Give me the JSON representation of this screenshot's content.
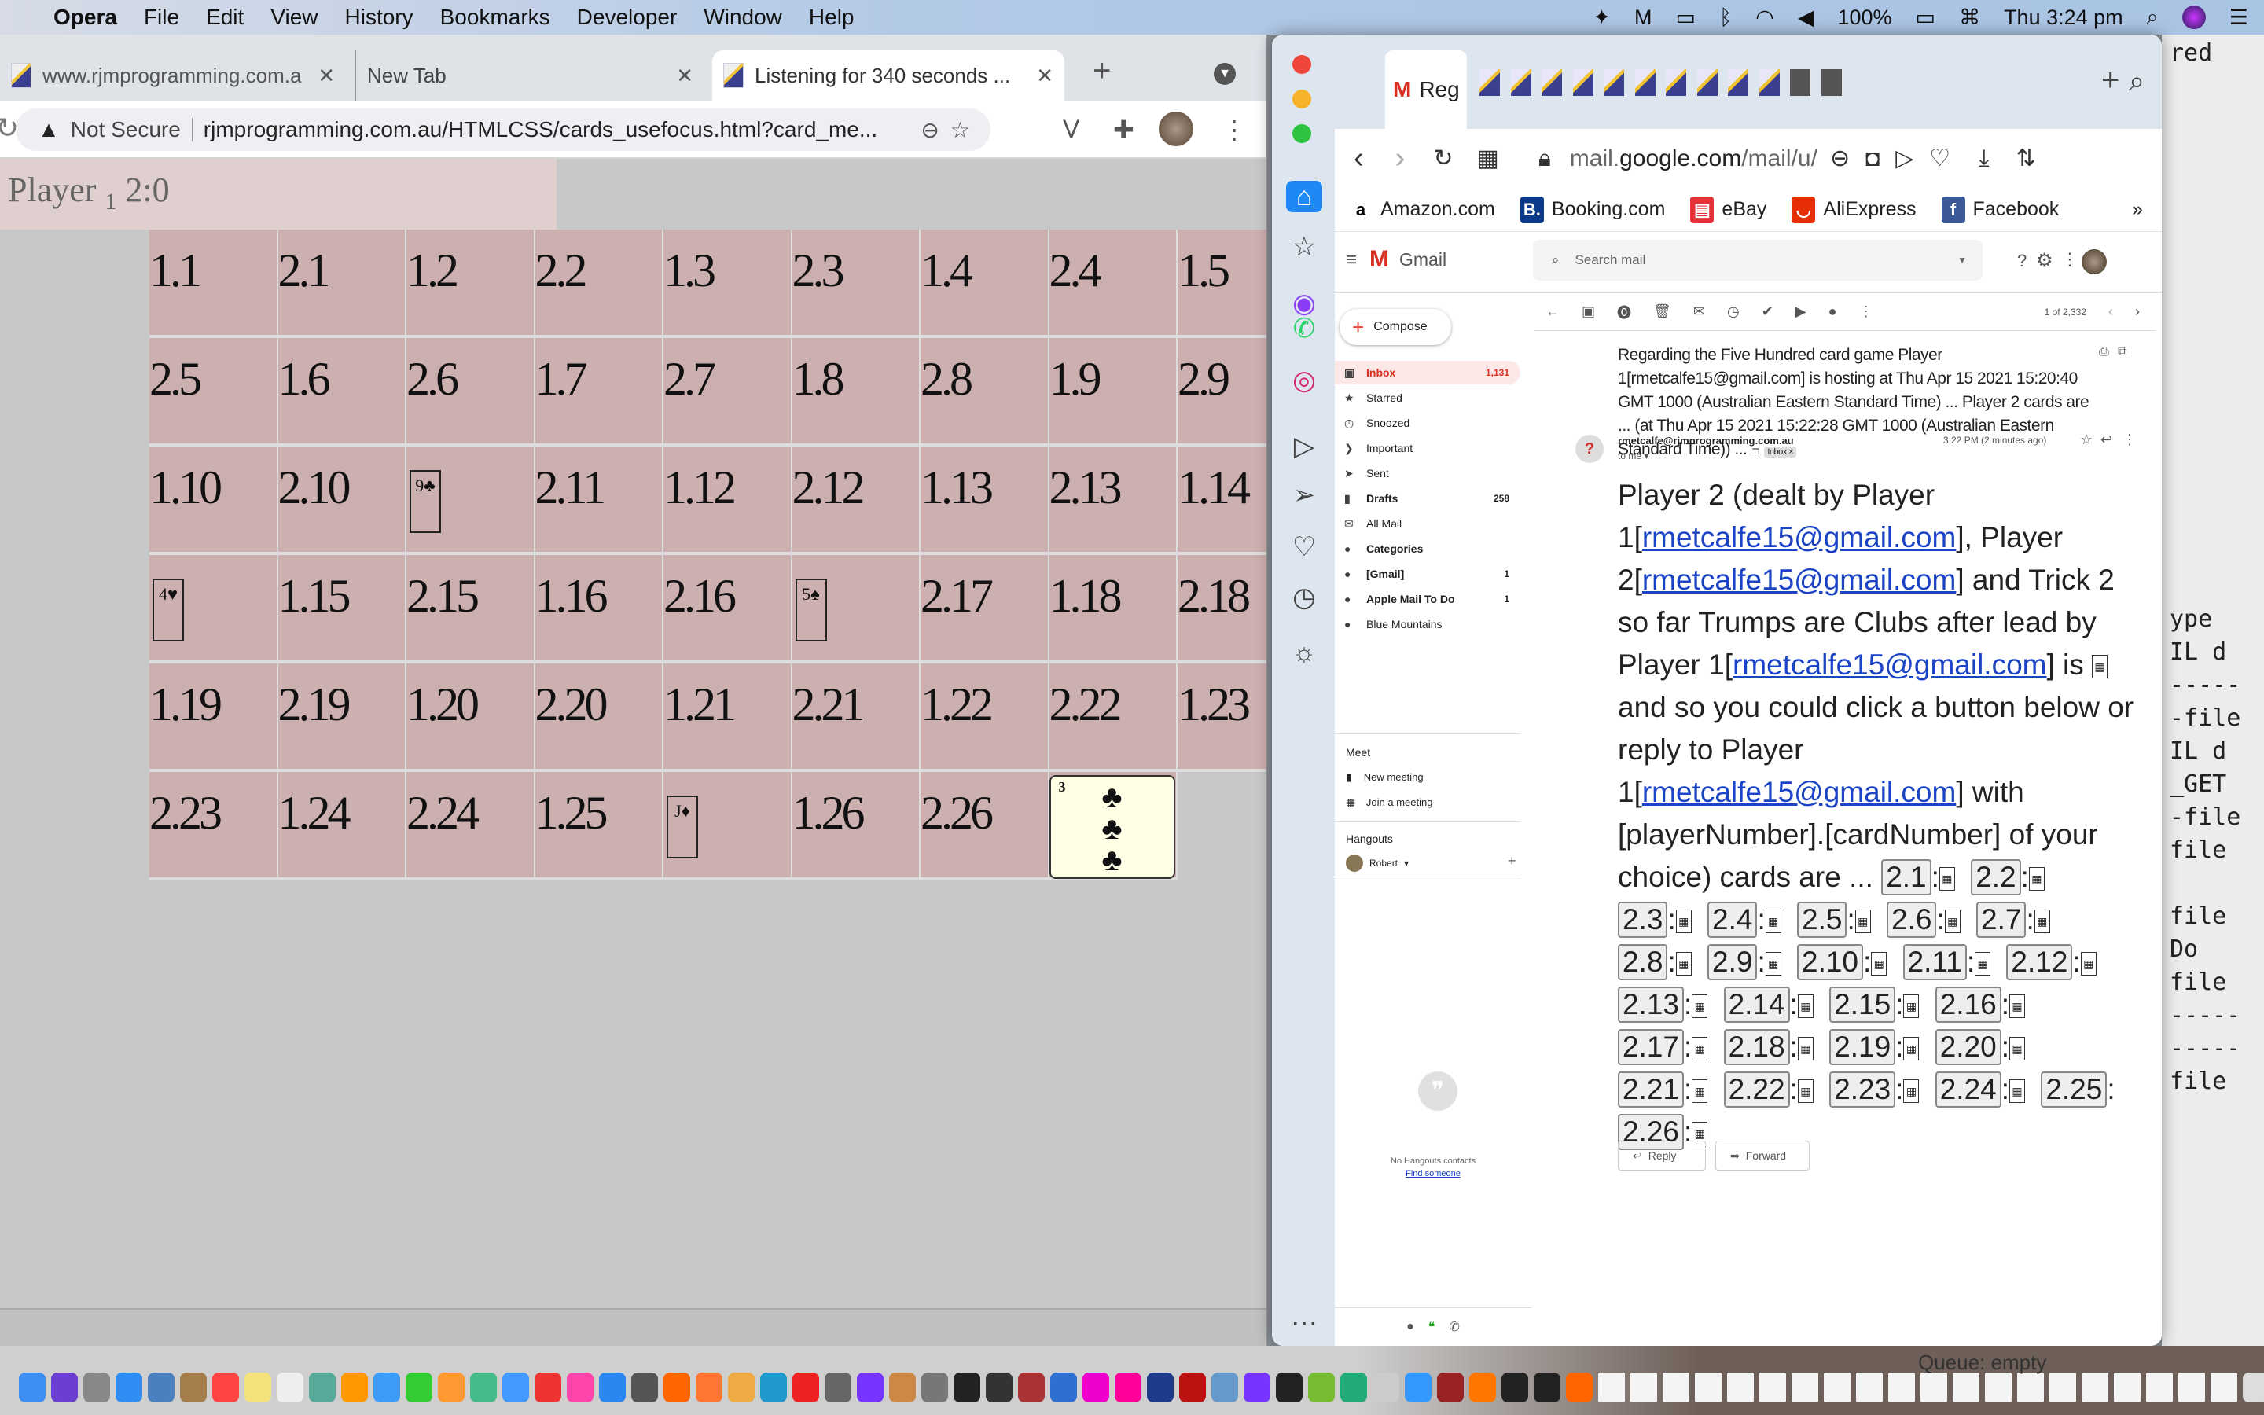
{
  "menubar": {
    "app": "Opera",
    "items": [
      "File",
      "Edit",
      "View",
      "History",
      "Bookmarks",
      "Developer",
      "Window",
      "Help"
    ],
    "status": {
      "battery": "100%",
      "clock": "Thu 3:24 pm"
    }
  },
  "left_browser": {
    "tabs": [
      {
        "label": "www.rjmprogramming.com.a",
        "active": false
      },
      {
        "label": "New Tab",
        "active": false
      },
      {
        "label": "Listening for 340 seconds ...",
        "active": true
      }
    ],
    "security": "Not Secure",
    "url": "rjmprogramming.com.au/HTMLCSS/cards_usefocus.html?card_me...",
    "score": {
      "prefix": "Player",
      "sub": "1",
      "value": "2:0"
    },
    "grid": [
      [
        "1.1",
        "2.1",
        "1.2",
        "2.2",
        "1.3",
        "2.3",
        "1.4",
        "2.4",
        "1.5"
      ],
      [
        "2.5",
        "1.6",
        "2.6",
        "1.7",
        "2.7",
        "1.8",
        "2.8",
        "1.9",
        "2.9"
      ],
      [
        "1.10",
        "2.10",
        {
          "card": "9♣"
        },
        "2.11",
        "1.12",
        "2.12",
        "1.13",
        "2.13",
        "1.14"
      ],
      [
        {
          "card": "4♥"
        },
        "1.15",
        "2.15",
        "1.16",
        "2.16",
        {
          "card": "5♠"
        },
        "2.17",
        "1.18",
        "2.18"
      ],
      [
        "1.19",
        "2.19",
        "1.20",
        "2.20",
        "1.21",
        "2.21",
        "1.22",
        "2.22",
        "1.23"
      ],
      [
        "2.23",
        "1.24",
        "2.24",
        "1.25",
        {
          "card": "J♦"
        },
        "1.26",
        "2.26",
        {
          "played": "3",
          "suit": "♣"
        },
        ""
      ]
    ]
  },
  "right_browser": {
    "active_tab": "Regar",
    "url": {
      "host_prefix": "mail.",
      "host": "google.com",
      "path": "/mail/u/"
    },
    "bookmarks": [
      {
        "label": "Amazon.com",
        "icon": "a",
        "color": "#ffffff"
      },
      {
        "label": "Booking.com",
        "icon": "B.",
        "color": "#0b3a8a"
      },
      {
        "label": "eBay",
        "icon": "bag",
        "color": "#e53238"
      },
      {
        "label": "AliExpress",
        "icon": "◡",
        "color": "#e62e04"
      },
      {
        "label": "Facebook",
        "icon": "f",
        "color": "#3b5998"
      }
    ],
    "more": "»"
  },
  "gmail": {
    "brand": "Gmail",
    "search_placeholder": "Search mail",
    "compose": "Compose",
    "nav": [
      {
        "label": "Inbox",
        "count": "1,131",
        "icon": "▣",
        "active": true,
        "bold": true
      },
      {
        "label": "Starred",
        "count": "",
        "icon": "★"
      },
      {
        "label": "Snoozed",
        "count": "",
        "icon": "◷"
      },
      {
        "label": "Important",
        "count": "",
        "icon": "❯"
      },
      {
        "label": "Sent",
        "count": "",
        "icon": "➤"
      },
      {
        "label": "Drafts",
        "count": "258",
        "icon": "▮",
        "bold": true
      },
      {
        "label": "All Mail",
        "count": "",
        "icon": "✉"
      },
      {
        "label": "Categories",
        "count": "",
        "icon": "●",
        "bold": true
      },
      {
        "label": "[Gmail]",
        "count": "1",
        "icon": "●",
        "bold": true
      },
      {
        "label": "Apple Mail To Do",
        "count": "1",
        "icon": "●",
        "bold": true
      },
      {
        "label": "Blue Mountains",
        "count": "",
        "icon": "●"
      }
    ],
    "meet": {
      "title": "Meet",
      "new_meeting": "New meeting",
      "join": "Join a meeting"
    },
    "hangouts": {
      "title": "Hangouts",
      "user": "Robert",
      "empty": "No Hangouts contacts",
      "find": "Find someone"
    },
    "pager": "1 of 2,332",
    "subject": "Regarding the Five Hundred card game Player 1[rmetcalfe15@gmail.com] is hosting at Thu Apr 15 2021 15:20:40 GMT 1000 (Australian Eastern Standard Time) ... Player 2 cards are ... (at Thu Apr 15 2021 15:22:28 GMT 1000 (Australian Eastern Standard Time)) ...",
    "label_chip": "Inbox ×",
    "sender": "rmetcalfe@rjmprogramming.com.au",
    "to": "to me ▾",
    "time": "3:22 PM (2 minutes ago)",
    "body": {
      "p1": "Player 2 (dealt by Player 1[",
      "email": "rmetcalfe15@gmail.com",
      "p2": "], Player 2[",
      "p3": "] and Trick 2 so far Trumps are Clubs after lead by Player 1[",
      "p4": "] is ",
      "p5": " and so you could click a button below or reply to Player 1[",
      "p6": "] with [playerNumber].[cardNumber] of your choice) cards are ... "
    },
    "card_buttons": [
      "2.1",
      "2.2",
      "2.3",
      "2.4",
      "2.5",
      "2.6",
      "2.7",
      "2.8",
      "2.9",
      "2.10",
      "2.11",
      "2.12",
      "2.13",
      "2.14",
      "2.15",
      "2.16",
      "2.17",
      "2.18",
      "2.19",
      "2.20",
      "2.21",
      "2.22",
      "2.23",
      "2.24",
      "2.25",
      "2.26"
    ],
    "reply": "Reply",
    "forward": "Forward"
  },
  "background_window": {
    "lines": [
      "red",
      "",
      "",
      "",
      "",
      "",
      "ype",
      "IL d",
      "-----",
      "-file",
      "IL d",
      "_GET",
      "-file",
      "file",
      "",
      "file",
      " Do",
      "file",
      "-----",
      "-----",
      "file"
    ]
  },
  "dock": {
    "queue": "Queue: empty"
  }
}
